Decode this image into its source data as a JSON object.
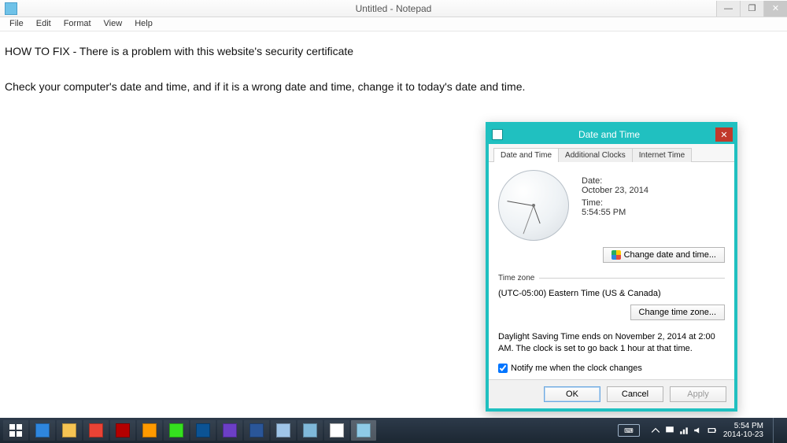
{
  "window": {
    "title": "Untitled - Notepad",
    "menu": {
      "file": "File",
      "edit": "Edit",
      "format": "Format",
      "view": "View",
      "help": "Help"
    }
  },
  "document": {
    "line1": "HOW TO FIX - There is a problem with this website's security certificate",
    "line2": "Check your computer's date and time, and if it is a wrong date and time, change it to today's date and time."
  },
  "dialog": {
    "title": "Date and Time",
    "tabs": {
      "t0": "Date and Time",
      "t1": "Additional Clocks",
      "t2": "Internet Time"
    },
    "date_label": "Date:",
    "date_value": "October 23, 2014",
    "time_label": "Time:",
    "time_value": "5:54:55 PM",
    "change_dt_btn": "Change date and time...",
    "tz_header": "Time zone",
    "tz_value": "(UTC-05:00) Eastern Time (US & Canada)",
    "change_tz_btn": "Change time zone...",
    "dst_text": "Daylight Saving Time ends on November 2, 2014 at 2:00 AM. The clock is set to go back 1 hour at that time.",
    "notify_label": "Notify me when the clock changes",
    "notify_checked": true,
    "buttons": {
      "ok": "OK",
      "cancel": "Cancel",
      "apply": "Apply"
    }
  },
  "taskbar": {
    "clock_time": "5:54 PM",
    "clock_date": "2014-10-23",
    "apps": [
      {
        "name": "start",
        "color": "#ffffff"
      },
      {
        "name": "ie",
        "color": "#2e86de"
      },
      {
        "name": "explorer",
        "color": "#f6c453"
      },
      {
        "name": "chrome",
        "color": "#ea4335"
      },
      {
        "name": "filezilla",
        "color": "#b30000"
      },
      {
        "name": "illustrator",
        "color": "#ff9a00"
      },
      {
        "name": "dreamweaver",
        "color": "#35e01f"
      },
      {
        "name": "photoshop",
        "color": "#0b5394"
      },
      {
        "name": "app-unknown-1",
        "color": "#6c3fc7"
      },
      {
        "name": "word",
        "color": "#2a5699"
      },
      {
        "name": "notepad-doc",
        "color": "#9fc5e8"
      },
      {
        "name": "sticky-notes",
        "color": "#7fb8d9"
      },
      {
        "name": "app-unknown-2",
        "color": "#ffffff"
      },
      {
        "name": "date-time-cpl",
        "color": "#8ecae6"
      }
    ]
  }
}
